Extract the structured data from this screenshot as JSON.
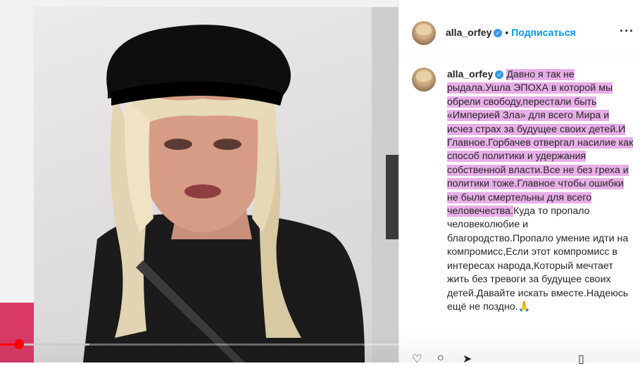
{
  "post": {
    "username": "alla_orfey",
    "separator": "•",
    "follow_label": "Подписаться",
    "more_label": "···",
    "caption_highlighted": "Давно я так не рыдала.Ушла ЭПОХА в которой мы обрели свободу,перестали быть «Империей Зла» для всего Мира и исчез страх за будущее своих детей.И Главное.Горбачев отвергал насилие как способ политики и удержания собственной власти.Все не без греха и политики тоже.Главное чтобы ошибки не были смертельны для всего человечества.",
    "caption_rest": "Куда то пропало человеколюбие и благородство.Пропало умение идти на компромисс,Если этот компромисс в интересах народа,Который мечтает жить без тревоги за будущее своих детей.Давайте искать вместе.Надеюсь ещё не поздно.",
    "caption_emoji": "🙏"
  },
  "player": {
    "progress": 0.03,
    "buffered": 0.14,
    "accent_color": "#ff0000"
  },
  "colors": {
    "highlight": "#e8aee8",
    "follow": "#0095f6",
    "verified": "#3897f0"
  }
}
